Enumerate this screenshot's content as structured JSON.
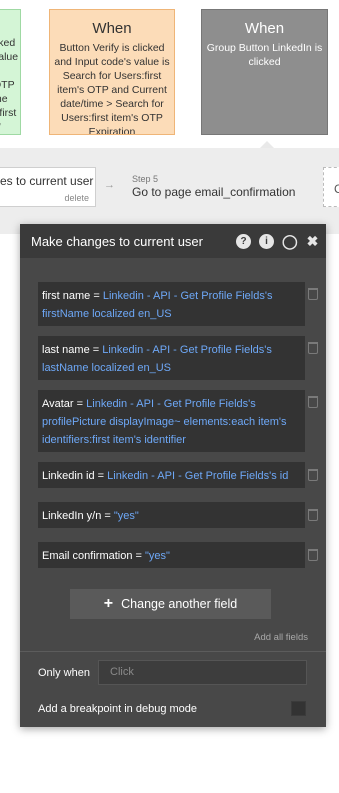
{
  "cards": [
    {
      "title": "",
      "text": "cked\nvalue\n\nOTP\nme\nr first\nn'"
    },
    {
      "title": "When",
      "text": "Button Verify is clicked and Input code's value is Search for Users:first item's OTP and Current date/time > Search for Users:first item's OTP Expiration"
    },
    {
      "title": "When",
      "text": "Group Button LinkedIn is clicked"
    }
  ],
  "steps": {
    "current_step_text": "es to current user",
    "delete_label": "delete",
    "arrow": "→",
    "step5_label": "Step 5",
    "step5_text": "Go to page email_confirmation",
    "next_partial": "C"
  },
  "panel": {
    "title": "Make changes to current user",
    "icons": [
      "help-icon",
      "info-icon",
      "comment-icon",
      "close-icon"
    ],
    "fields": [
      {
        "key": "first name",
        "eq": " = ",
        "value": "Linkedin - API - Get Profile Fields's firstName localized en_US"
      },
      {
        "key": "last name",
        "eq": " = ",
        "value": "Linkedin - API - Get Profile Fields's lastName localized en_US"
      },
      {
        "key": "Avatar",
        "eq": " = ",
        "value": "Linkedin - API - Get Profile Fields's profilePicture displayImage~ elements:each item's identifiers:first item's identifier"
      },
      {
        "key": "Linkedin id",
        "eq": " = ",
        "value": "Linkedin - API - Get Profile Fields's id"
      },
      {
        "key": "LinkedIn y/n",
        "eq": " = ",
        "value": "\"yes\""
      },
      {
        "key": "Email confirmation",
        "eq": " = ",
        "value": "\"yes\""
      }
    ],
    "change_button": "Change another field",
    "add_all": "Add all fields",
    "only_when_label": "Only when",
    "only_when_placeholder": "Click",
    "breakpoint_label": "Add a breakpoint in debug mode"
  }
}
